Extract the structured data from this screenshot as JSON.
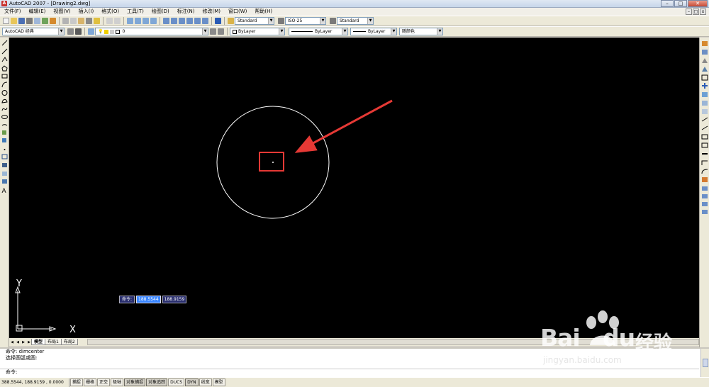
{
  "window": {
    "title": "AutoCAD 2007 - [Drawing2.dwg]",
    "app_icon": "autocad-logo-icon"
  },
  "menu": [
    "文件(F)",
    "编辑(E)",
    "视图(V)",
    "插入(I)",
    "格式(O)",
    "工具(T)",
    "绘图(D)",
    "标注(N)",
    "修改(M)",
    "窗口(W)",
    "帮助(H)"
  ],
  "toolbar_styles": {
    "text_style": "Standard",
    "dim_style": "ISO-25",
    "table_style": "Standard"
  },
  "properties_toolbar": {
    "workspace": "AutoCAD 经典",
    "layer": "0",
    "color": "ByLayer",
    "linetype": "ByLayer",
    "lineweight": "ByLayer",
    "plot_style": "随颜色"
  },
  "dynamic_input": {
    "label": "命令:",
    "x_value": "188.5544",
    "y_value": "188.9159"
  },
  "ucs": {
    "x_label": "X",
    "y_label": "Y"
  },
  "layout_tabs": [
    "模型",
    "布局1",
    "布局2"
  ],
  "command_history": [
    "命令:  dimcenter",
    "选择圆弧或圆:"
  ],
  "command_prompt": "命令:",
  "status": {
    "coordinates": "388.5544, 188.9159 , 0.0000",
    "toggles": [
      "捕捉",
      "栅格",
      "正交",
      "极轴",
      "对象捕捉",
      "对象追踪",
      "DUCS",
      "DYN",
      "线宽",
      "模型"
    ]
  },
  "watermark": {
    "brand": "Bai",
    "brand_suffix": "du",
    "cn": "经验",
    "url": "jingyan.baidu.com"
  },
  "colors": {
    "canvas": "#000000",
    "circle": "#ffffff",
    "annotation": "#e53935"
  }
}
